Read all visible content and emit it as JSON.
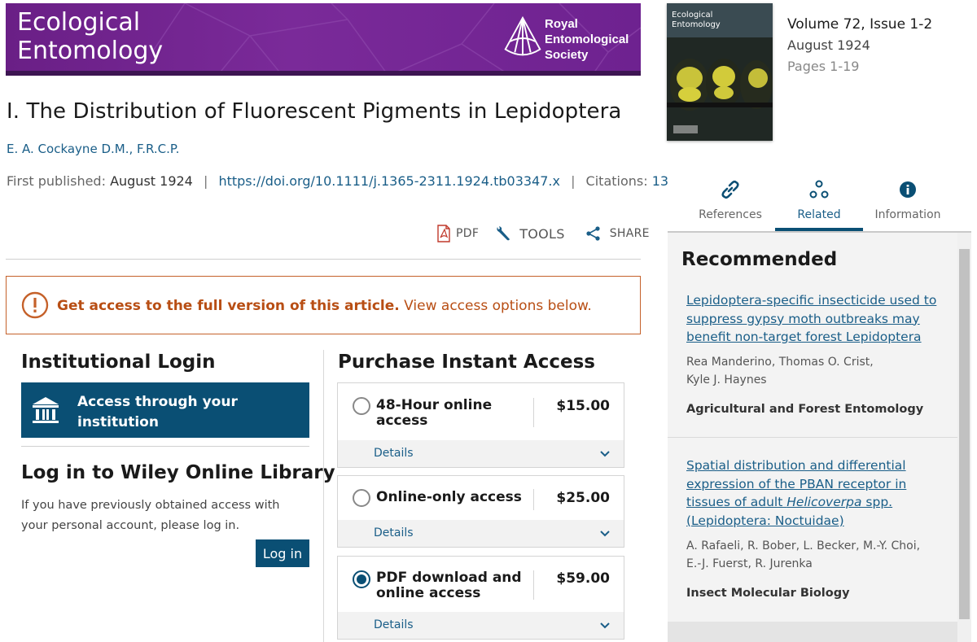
{
  "journal": {
    "title_line1": "Ecological",
    "title_line2": "Entomology",
    "society_line1": "Royal",
    "society_line2": "Entomological",
    "society_line3": "Society"
  },
  "article": {
    "title": "I. The Distribution of Fluorescent Pigments in Lepidoptera",
    "authors": "E. A. Cockayne D.M., F.R.C.P.",
    "first_published_label": "First published:",
    "first_published": "August 1924",
    "separator": "|",
    "doi": "https://doi.org/10.1111/j.1365-2311.1924.tb03347.x",
    "citations_label": "Citations:",
    "citations": "13"
  },
  "toolbar": {
    "pdf_label": "PDF",
    "tools_label": "TOOLS",
    "share_label": "SHARE"
  },
  "alert": {
    "bold_text": "Get access to the full version of this article.",
    "rest_text": "View access options below."
  },
  "login": {
    "institutional_heading": "Institutional Login",
    "institution_button": "Access through your institution",
    "wol_heading": "Log in to Wiley Online Library",
    "wol_text": "If you have previously obtained access with your personal account, please log in.",
    "login_button": "Log in"
  },
  "purchase": {
    "heading": "Purchase Instant Access",
    "details_label": "Details",
    "options": [
      {
        "name": "48-Hour online access",
        "price": "$15.00",
        "selected": false
      },
      {
        "name": "Online-only access",
        "price": "$25.00",
        "selected": false
      },
      {
        "name": "PDF download and online access",
        "price": "$59.00",
        "selected": true
      }
    ]
  },
  "issue": {
    "cover_title_line1": "Ecological",
    "cover_title_line2": "Entomology",
    "volume": "Volume 72, Issue 1-2",
    "date": "August 1924",
    "pages": "Pages 1-19"
  },
  "tabs": [
    {
      "label": "References",
      "icon": "link-icon",
      "active": false
    },
    {
      "label": "Related",
      "icon": "related-nodes-icon",
      "active": true
    },
    {
      "label": "Information",
      "icon": "info-icon",
      "active": false
    }
  ],
  "recommended": {
    "heading": "Recommended",
    "items": [
      {
        "title": "Lepidoptera-specific insecticide used to suppress gypsy moth outbreaks may benefit non-target forest Lepidoptera",
        "authors_line1": "Rea Manderino, Thomas O. Crist,",
        "authors_line2": "Kyle J. Haynes",
        "journal": "Agricultural and Forest Entomology"
      },
      {
        "title_part1": "Spatial distribution and differential expression of the PBAN receptor in tissues of adult ",
        "title_italic": "Helicoverpa",
        "title_part2": " spp. (Lepidoptera: Noctuidae)",
        "authors_line1": "A. Rafaeli, R. Bober, L. Becker, M.-Y. Choi,",
        "authors_line2": "E.-J. Fuerst, R. Jurenka",
        "journal": "Insect Molecular Biology"
      }
    ]
  },
  "colors": {
    "banner_purple": "#6a1f86",
    "wiley_blue": "#0a4f74",
    "link_blue": "#1a5e88",
    "alert_orange": "#b84e14"
  }
}
